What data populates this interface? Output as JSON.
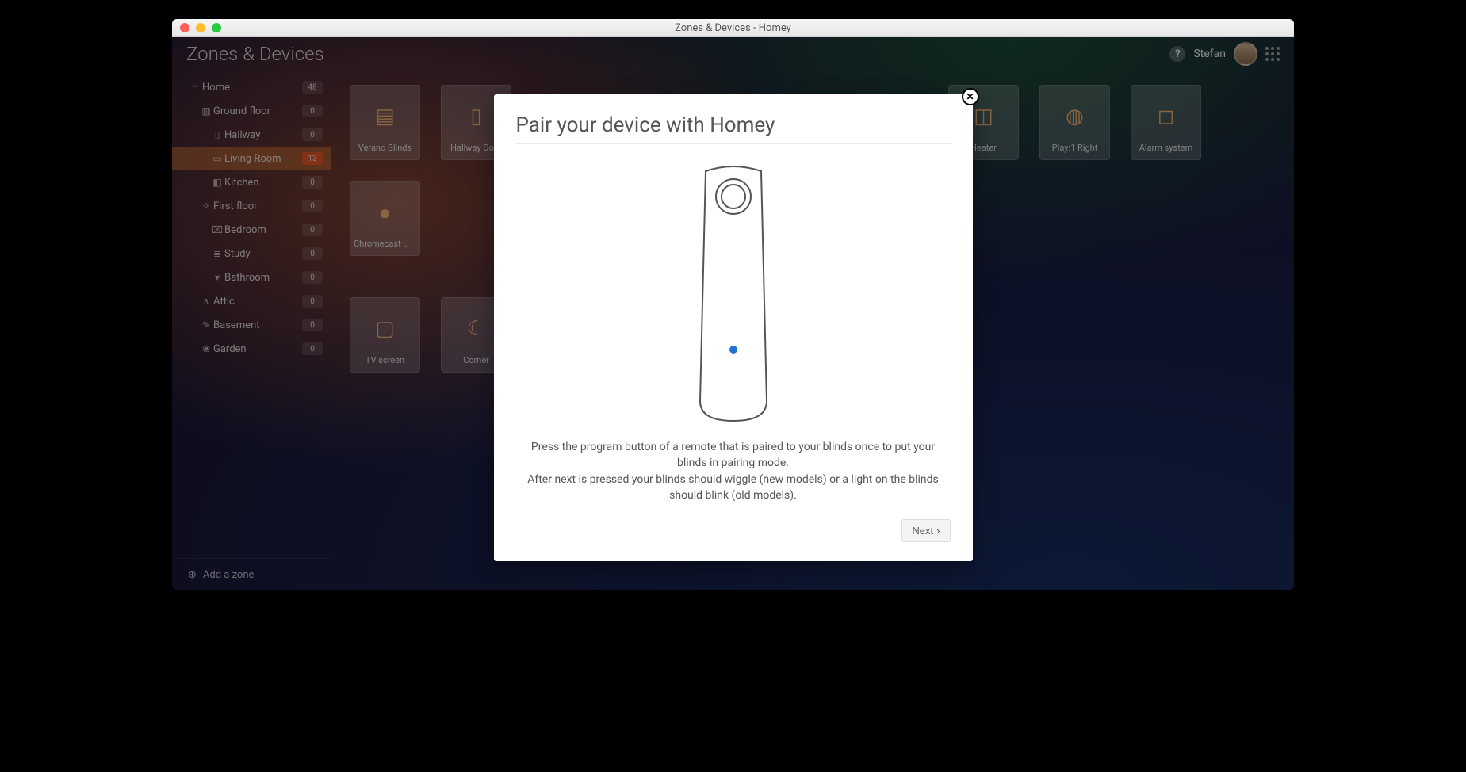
{
  "window": {
    "title": "Zones & Devices - Homey"
  },
  "header": {
    "page_title": "Zones & Devices",
    "user_name": "Stefan",
    "help_glyph": "?"
  },
  "sidebar": {
    "items": [
      {
        "label": "Home",
        "icon": "⌂",
        "count": "48",
        "level": 0,
        "active": false
      },
      {
        "label": "Ground floor",
        "icon": "▥",
        "count": "0",
        "level": 1,
        "active": false
      },
      {
        "label": "Hallway",
        "icon": "▯",
        "count": "0",
        "level": 2,
        "active": false
      },
      {
        "label": "Living Room",
        "icon": "▭",
        "count": "13",
        "level": 2,
        "active": true
      },
      {
        "label": "Kitchen",
        "icon": "◧",
        "count": "0",
        "level": 2,
        "active": false
      },
      {
        "label": "First floor",
        "icon": "✧",
        "count": "0",
        "level": 1,
        "active": false
      },
      {
        "label": "Bedroom",
        "icon": "⌧",
        "count": "0",
        "level": 2,
        "active": false
      },
      {
        "label": "Study",
        "icon": "≣",
        "count": "0",
        "level": 2,
        "active": false
      },
      {
        "label": "Bathroom",
        "icon": "▾",
        "count": "0",
        "level": 2,
        "active": false
      },
      {
        "label": "Attic",
        "icon": "∧",
        "count": "0",
        "level": 1,
        "active": false
      },
      {
        "label": "Basement",
        "icon": "✎",
        "count": "0",
        "level": 1,
        "active": false
      },
      {
        "label": "Garden",
        "icon": "❀",
        "count": "0",
        "level": 1,
        "active": false
      }
    ],
    "add_zone_label": "Add a zone"
  },
  "devices": [
    {
      "label": "Verano Blinds",
      "icon": "▤"
    },
    {
      "label": "Hallway Door",
      "icon": "▯"
    },
    {
      "label": "Heater",
      "icon": "◫"
    },
    {
      "label": "Play:1 Right",
      "icon": "◍"
    },
    {
      "label": "Alarm system",
      "icon": "◻"
    },
    {
      "label": "Chromecast m…",
      "icon": "●"
    },
    {
      "label": "TV screen",
      "icon": "▢"
    },
    {
      "label": "Corner",
      "icon": "☾"
    }
  ],
  "modal": {
    "title": "Pair your device with Homey",
    "line1": "Press the program button of a remote that is paired to your blinds once to put your blinds in pairing mode.",
    "line2": "After next is pressed your blinds should wiggle (new models) or a light on the blinds should blink (old models).",
    "next_label": "Next",
    "close_glyph": "✕"
  }
}
